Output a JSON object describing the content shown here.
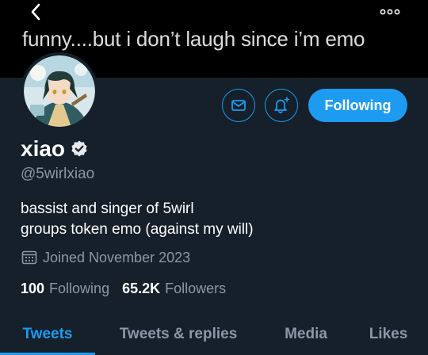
{
  "header": {
    "banner_text": "funny....but i don’t laugh since i’m emo"
  },
  "actions": {
    "follow_label": "Following"
  },
  "profile": {
    "name": "xiao",
    "handle": "@5wirlxiao",
    "bio_line1": "bassist and singer of 5wirl",
    "bio_line2": "groups token emo (against my will)",
    "joined": "Joined November 2023",
    "following_count": "100",
    "following_label": "Following",
    "followers_count": "65.2K",
    "followers_label": "Followers"
  },
  "tabs": [
    {
      "label": "Tweets",
      "active": true
    },
    {
      "label": "Tweets & replies",
      "active": false
    },
    {
      "label": "Media",
      "active": false
    },
    {
      "label": "Likes",
      "active": false
    }
  ],
  "colors": {
    "accent": "#1d9bf0",
    "background": "#15202b",
    "header_background": "#000000",
    "secondary_text": "#8b98a5"
  },
  "icons": {
    "back": "chevron-left-icon",
    "more": "more-horizontal-icon",
    "message": "mail-icon",
    "notify": "bell-plus-icon",
    "verified": "verified-badge-icon",
    "joined": "calendar-icon"
  }
}
